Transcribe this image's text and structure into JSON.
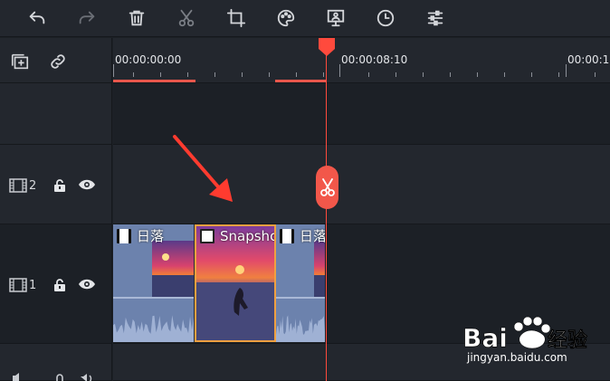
{
  "toolbar": {
    "buttons": [
      {
        "name": "undo-icon"
      },
      {
        "name": "redo-icon"
      },
      {
        "name": "delete-icon"
      },
      {
        "name": "cut-icon"
      },
      {
        "name": "crop-icon"
      },
      {
        "name": "color-palette-icon"
      },
      {
        "name": "green-screen-icon"
      },
      {
        "name": "speed-clock-icon"
      },
      {
        "name": "adjust-sliders-icon"
      }
    ]
  },
  "timeline": {
    "timecodes": [
      "00:00:00:00",
      "00:00:08:10",
      "00:00:1"
    ],
    "tracks": [
      {
        "number": "2"
      },
      {
        "number": "1"
      }
    ],
    "clips": [
      {
        "label": "日落",
        "type": "video"
      },
      {
        "label": "Snapsho",
        "type": "image"
      },
      {
        "label": "日落",
        "type": "video"
      }
    ]
  },
  "colors": {
    "accent": "#f2574a",
    "playhead": "#ff4a3d",
    "selected_clip_border": "#f0a040",
    "background": "#1c2026",
    "panel": "#23272e"
  },
  "watermark": {
    "brand": "Bai",
    "brand2": "经验",
    "url": "jingyan.baidu.com"
  }
}
